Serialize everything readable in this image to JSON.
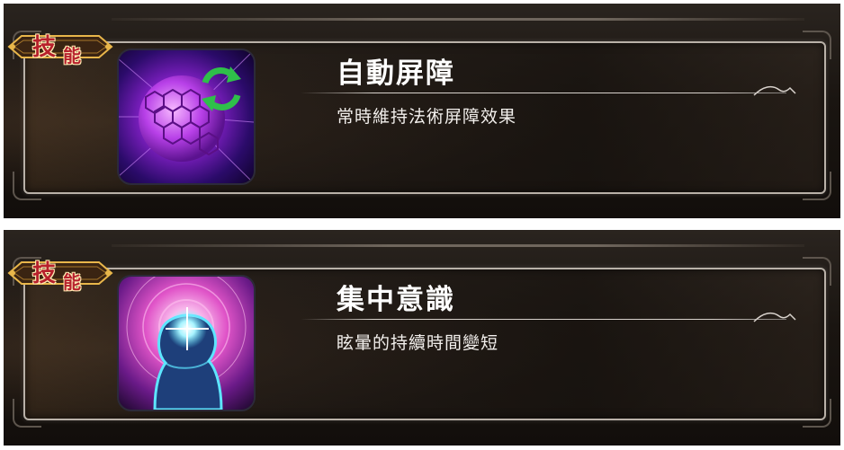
{
  "skills": [
    {
      "badge": {
        "char1": "技",
        "char2": "能"
      },
      "icon": "hex-shield-refresh-icon",
      "title": "自動屏障",
      "description": "常時維持法術屏障效果"
    },
    {
      "badge": {
        "char1": "技",
        "char2": "能"
      },
      "icon": "glowing-head-focus-icon",
      "title": "集中意識",
      "description": "眩暈的持續時間變短"
    }
  ],
  "colors": {
    "badge_text": "#b7212b",
    "badge_gold": "#e8b64a",
    "shield_purple": "#9a2bd6",
    "refresh_green": "#2fbf4a",
    "focus_pink": "#e054c8",
    "focus_cyan": "#5de6ff"
  }
}
